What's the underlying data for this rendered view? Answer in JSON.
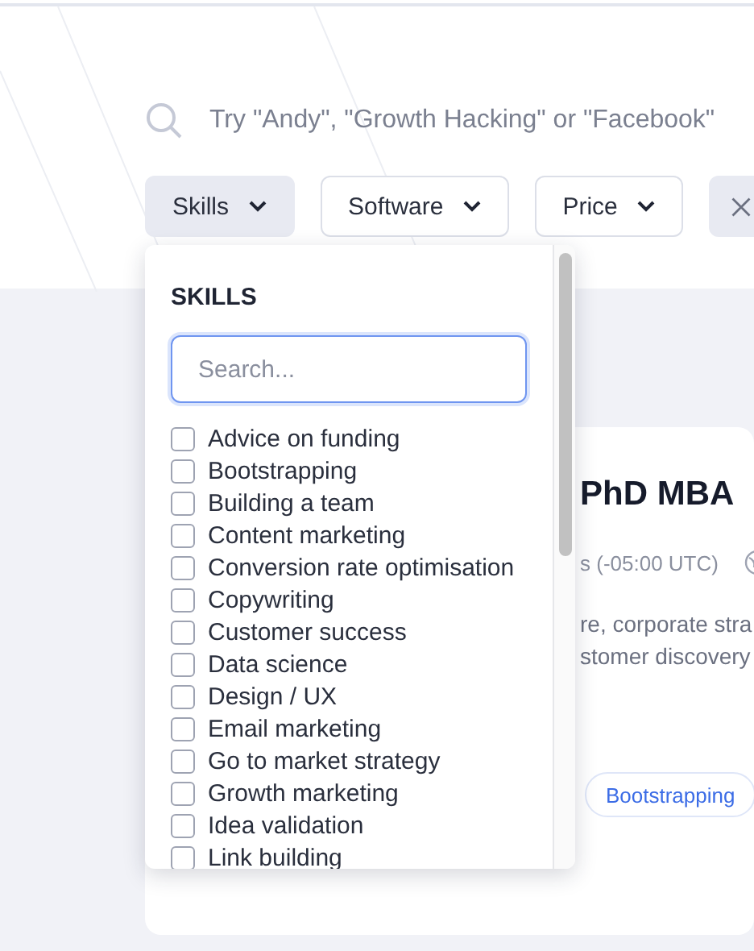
{
  "search": {
    "placeholder": "Try \"Andy\", \"Growth Hacking\" or \"Facebook\""
  },
  "filters": [
    {
      "label": "Skills",
      "selected": true
    },
    {
      "label": "Software",
      "selected": false
    },
    {
      "label": "Price",
      "selected": false
    }
  ],
  "dropdown": {
    "heading": "SKILLS",
    "search_placeholder": "Search...",
    "items": [
      {
        "label": "Advice on funding",
        "checked": false
      },
      {
        "label": "Bootstrapping",
        "checked": false
      },
      {
        "label": "Building a team",
        "checked": false
      },
      {
        "label": "Content marketing",
        "checked": false
      },
      {
        "label": "Conversion rate optimisation",
        "checked": false
      },
      {
        "label": "Copywriting",
        "checked": false
      },
      {
        "label": "Customer success",
        "checked": false
      },
      {
        "label": "Data science",
        "checked": false
      },
      {
        "label": "Design / UX",
        "checked": false
      },
      {
        "label": "Email marketing",
        "checked": false
      },
      {
        "label": "Go to market strategy",
        "checked": false
      },
      {
        "label": "Growth marketing",
        "checked": false
      },
      {
        "label": "Idea validation",
        "checked": false
      },
      {
        "label": "Link building",
        "checked": false
      }
    ]
  },
  "card": {
    "title": "PhD MBA",
    "timezone": "s (-05:00 UTC)",
    "bio": [
      "re, corporate stra",
      "stomer discovery"
    ],
    "tags": [
      "Bootstrapping"
    ]
  }
}
